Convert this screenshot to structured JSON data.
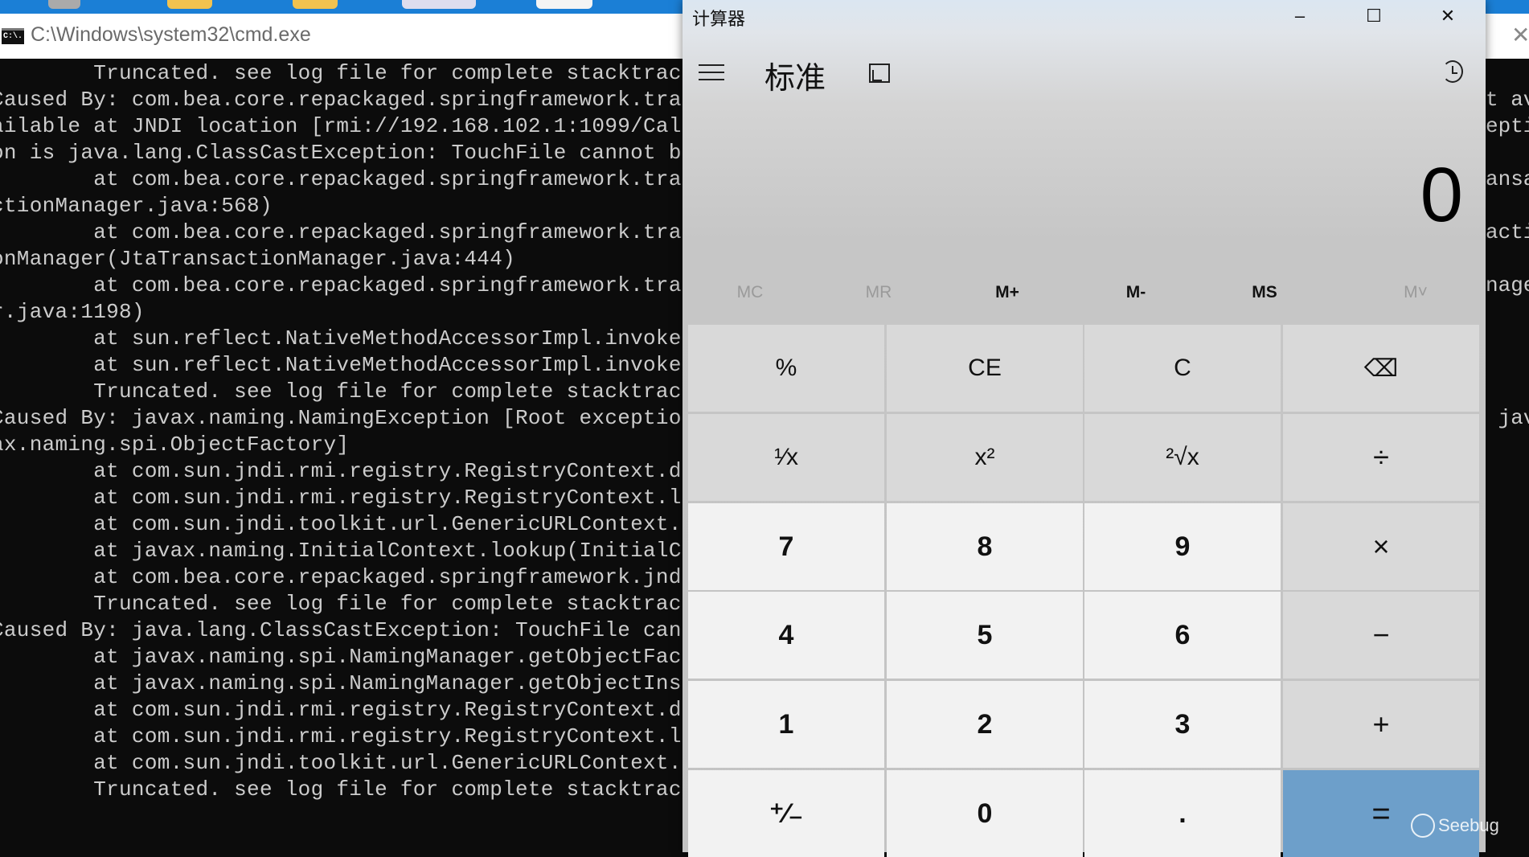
{
  "taskbar": {
    "color": "#1b7fd6"
  },
  "cmd": {
    "title": "C:\\Windows\\system32\\cmd.exe",
    "icon_label": "C:\\.",
    "close": "✕",
    "lines": [
      "        Truncated. see log file for complete stacktrac",
      "Caused By: com.bea.core.repackaged.springframework.tra",
      "ailable at JNDI location [rmi://192.168.102.1:1099/Cal",
      "on is java.lang.ClassCastException: TouchFile cannot b",
      "        at com.bea.core.repackaged.springframework.tra",
      "ctionManager.java:568)",
      "        at com.bea.core.repackaged.springframework.tra",
      "onManager(JtaTransactionManager.java:444)",
      "        at com.bea.core.repackaged.springframework.tra",
      "r.java:1198)",
      "        at sun.reflect.NativeMethodAccessorImpl.invoke",
      "        at sun.reflect.NativeMethodAccessorImpl.invoke",
      "        Truncated. see log file for complete stacktrac",
      "Caused By: javax.naming.NamingException [Root exceptio",
      "ax.naming.spi.ObjectFactory]",
      "        at com.sun.jndi.rmi.registry.RegistryContext.d",
      "        at com.sun.jndi.rmi.registry.RegistryContext.l",
      "        at com.sun.jndi.toolkit.url.GenericURLContext.",
      "        at javax.naming.InitialContext.lookup(InitialC",
      "        at com.bea.core.repackaged.springframework.jnd",
      "        Truncated. see log file for complete stacktrac",
      "Caused By: java.lang.ClassCastException: TouchFile can",
      "        at javax.naming.spi.NamingManager.getObjectFac",
      "        at javax.naming.spi.NamingManager.getObjectIns",
      "        at com.sun.jndi.rmi.registry.RegistryContext.d",
      "        at com.sun.jndi.rmi.registry.RegistryContext.l",
      "        at com.sun.jndi.toolkit.url.GenericURLContext.",
      "        Truncated. see log file for complete stacktrac"
    ],
    "right_fragments": [
      "",
      "t av",
      "epti",
      "",
      "ansa",
      "",
      "acti",
      "",
      "nage",
      "",
      "",
      "",
      "",
      " jav",
      "",
      "",
      "",
      "",
      "",
      "",
      "",
      "",
      "",
      "",
      "",
      "",
      "",
      ""
    ]
  },
  "calculator": {
    "title": "计算器",
    "minimize": "–",
    "maximize": "☐",
    "close": "✕",
    "mode": "标准",
    "display": "0",
    "memory": [
      {
        "label": "MC",
        "enabled": false
      },
      {
        "label": "MR",
        "enabled": false
      },
      {
        "label": "M+",
        "enabled": true
      },
      {
        "label": "M-",
        "enabled": true
      },
      {
        "label": "MS",
        "enabled": true
      },
      {
        "label": "M˅",
        "enabled": false
      }
    ],
    "keys": [
      [
        {
          "label": "%",
          "kind": "fn"
        },
        {
          "label": "CE",
          "kind": "fn"
        },
        {
          "label": "C",
          "kind": "fn"
        },
        {
          "label": "⌫",
          "kind": "fn"
        }
      ],
      [
        {
          "label": "¹⁄x",
          "kind": "fn"
        },
        {
          "label": "x²",
          "kind": "fn"
        },
        {
          "label": "²√x",
          "kind": "fn"
        },
        {
          "label": "÷",
          "kind": "op"
        }
      ],
      [
        {
          "label": "7",
          "kind": "num"
        },
        {
          "label": "8",
          "kind": "num"
        },
        {
          "label": "9",
          "kind": "num"
        },
        {
          "label": "×",
          "kind": "op"
        }
      ],
      [
        {
          "label": "4",
          "kind": "num"
        },
        {
          "label": "5",
          "kind": "num"
        },
        {
          "label": "6",
          "kind": "num"
        },
        {
          "label": "−",
          "kind": "op"
        }
      ],
      [
        {
          "label": "1",
          "kind": "num"
        },
        {
          "label": "2",
          "kind": "num"
        },
        {
          "label": "3",
          "kind": "num"
        },
        {
          "label": "+",
          "kind": "op"
        }
      ],
      [
        {
          "label": "⁺⁄₋",
          "kind": "num"
        },
        {
          "label": "0",
          "kind": "num"
        },
        {
          "label": ".",
          "kind": "num"
        },
        {
          "label": "=",
          "kind": "eq"
        }
      ]
    ],
    "equals_color": "#6d9fca"
  },
  "watermark": {
    "text": "Seebug"
  }
}
